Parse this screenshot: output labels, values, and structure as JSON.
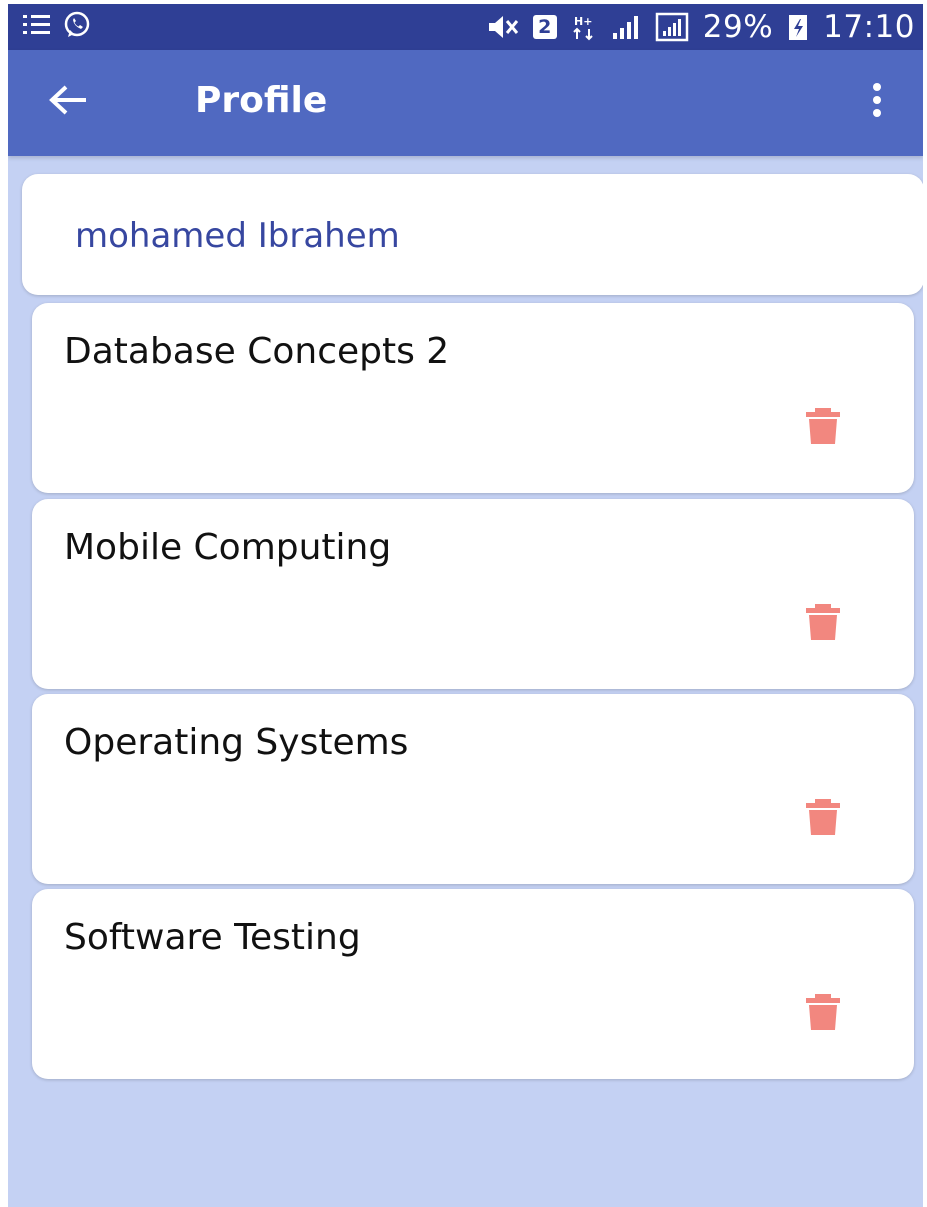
{
  "status_bar": {
    "battery_percent": "29%",
    "time": "17:10",
    "sim_label": "2",
    "icons": [
      "list-icon",
      "whatsapp-icon",
      "mute-icon",
      "sim-icon",
      "data-icon",
      "signal-icon",
      "signal-icon-2",
      "battery-icon"
    ]
  },
  "app_bar": {
    "title": "Profile",
    "back_icon": "arrow-left-icon",
    "menu_icon": "more-vert-icon"
  },
  "profile": {
    "name": "mohamed Ibrahem"
  },
  "courses": [
    {
      "title": "Database Concepts 2",
      "action_icon": "trash-icon"
    },
    {
      "title": "Mobile Computing",
      "action_icon": "trash-icon"
    },
    {
      "title": "Operating Systems",
      "action_icon": "trash-icon"
    },
    {
      "title": "Software Testing",
      "action_icon": "trash-icon"
    }
  ],
  "colors": {
    "status_bar": "#2f3f95",
    "app_bar": "#5069c1",
    "background": "#c4d1f3",
    "name_text": "#3747a0",
    "delete_icon": "#f2877f"
  }
}
